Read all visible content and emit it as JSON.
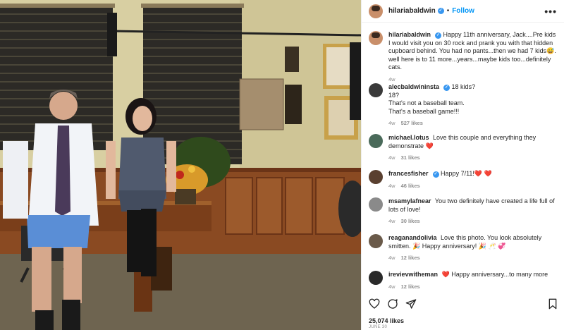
{
  "post": {
    "author": "hilariabaldwin",
    "follow_label": "Follow",
    "more_label": "•••",
    "photo_caption_alt": "",
    "likes": "25,074 likes",
    "date": "JUNE 30"
  },
  "caption": {
    "user": "hilariabaldwin",
    "text": "Happy 11th anniversary, Jack....Pre kids I would visit you on 30 rock and prank you with that hidden cupboard behind. You had no pants...then we had 7 kids😅. well here is to 11 more...years...maybe kids too...definitely cats.",
    "time": "4w"
  },
  "comments": [
    {
      "user": "alecbaldwininsta",
      "verified": true,
      "lines": [
        "18 kids?",
        "18?",
        "That's not a baseball team.",
        "That's a baseball game!!!"
      ],
      "time": "4w",
      "likes": "527 likes"
    },
    {
      "user": "michael.lotus",
      "verified": false,
      "text": "Love this couple and everything they demonstrate ❤️",
      "time": "4w",
      "likes": "31 likes"
    },
    {
      "user": "francesfisher",
      "verified": true,
      "text": "Happy 7/11!❤️ ❤️",
      "time": "4w",
      "likes": "46 likes"
    },
    {
      "user": "msamylafnear",
      "verified": false,
      "text": "You two definitely have created a life full of lots of love!",
      "time": "4w",
      "likes": "30 likes"
    },
    {
      "user": "reaganandolivia",
      "verified": false,
      "text": "Love this photo. You look absolutely smitten. 🎉 Happy anniversary! 🎉 🥂 💞",
      "time": "4w",
      "likes": "12 likes"
    },
    {
      "user": "irevievwitheman",
      "verified": false,
      "text": "❤️ Happy anniversary...to many more",
      "time": "4w",
      "likes": "12 likes"
    }
  ],
  "colors": {
    "link": "#0095f6",
    "verified": "#3897f0",
    "meta": "#8e8e8e",
    "heart": "#ed4956"
  },
  "icons": [
    "heart-icon",
    "comment-icon",
    "share-icon",
    "bookmark-icon",
    "verified-badge-icon"
  ]
}
